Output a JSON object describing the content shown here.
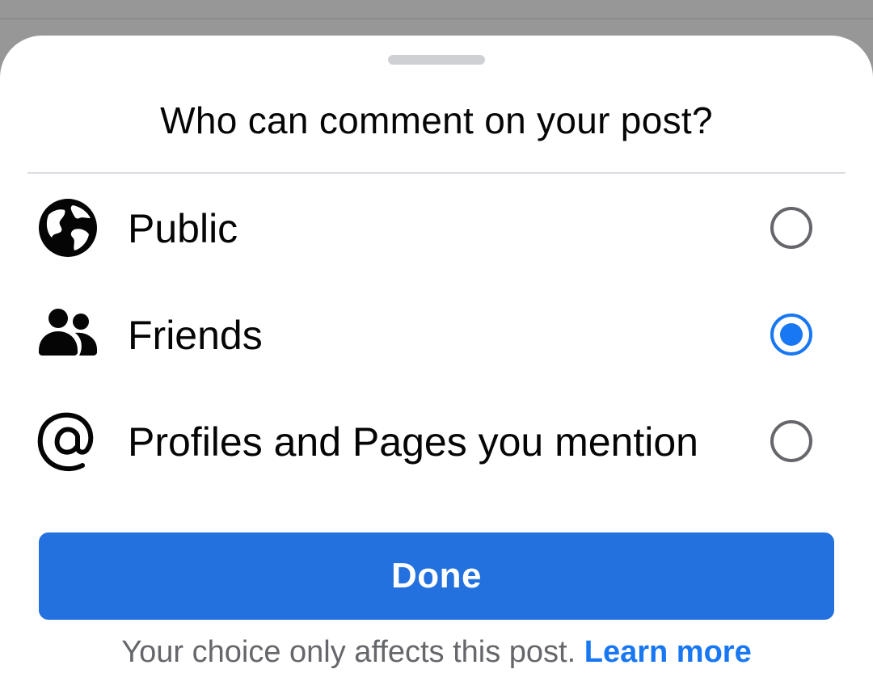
{
  "sheet": {
    "title": "Who can comment on your post?",
    "options": [
      {
        "label": "Public",
        "icon": "globe-icon",
        "selected": false
      },
      {
        "label": "Friends",
        "icon": "friends-icon",
        "selected": true
      },
      {
        "label": "Profiles and Pages you mention",
        "icon": "at-sign-icon",
        "selected": false
      }
    ],
    "done_label": "Done",
    "footer_text": "Your choice only affects this post.",
    "footer_link": "Learn more"
  },
  "colors": {
    "accent": "#1877f2",
    "button": "#2371de",
    "overlay": "#979797",
    "secondary_text": "#65676b"
  }
}
